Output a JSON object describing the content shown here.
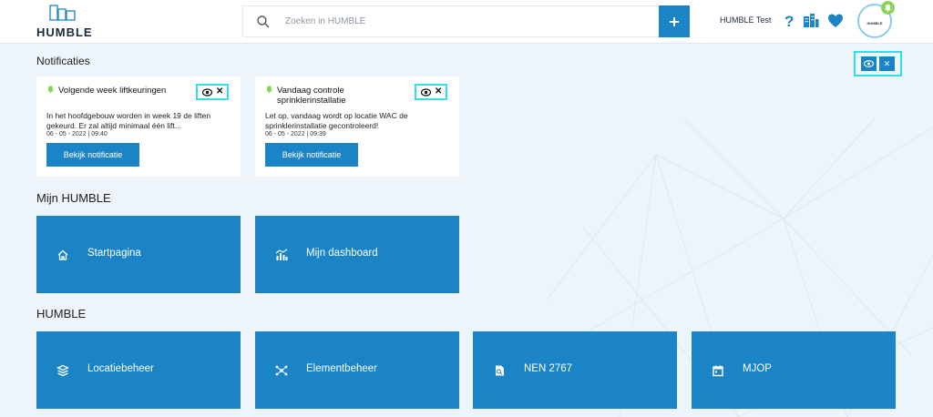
{
  "header": {
    "logo_text": "HUMBLE",
    "search_placeholder": "Zoeken in HUMBLE",
    "add_label": "+",
    "user_name": "HUMBLE Test",
    "avatar_text": "HUMBLE",
    "icons": [
      "search-icon",
      "plus-icon",
      "help-icon",
      "buildings-icon",
      "heart-icon",
      "bell-icon"
    ]
  },
  "notifications": {
    "title": "Notificaties",
    "cards": [
      {
        "title": "Volgende week liftkeuringen",
        "body": "In het hoofdgebouw worden in week 19 de liften gekeurd. Er zal altijd minimaal één lift...",
        "date": "06 - 05 - 2022 | 09:40",
        "button": "Bekijk notificatie"
      },
      {
        "title": "Vandaag controle sprinklerinstallatie",
        "body": "Let op, vandaag wordt op locatie WAC de sprinklerinstallatie gecontroleerd!",
        "date": "06 - 05 - 2022 | 09:39",
        "button": "Bekijk notificatie"
      }
    ],
    "close_glyph": "✕"
  },
  "mijn_humble": {
    "title": "Mijn HUMBLE",
    "tiles": [
      {
        "label": "Startpagina",
        "icon": "home-icon"
      },
      {
        "label": "Mijn dashboard",
        "icon": "dashboard-icon"
      }
    ]
  },
  "humble": {
    "title": "HUMBLE",
    "tiles": [
      {
        "label": "Locatiebeheer",
        "icon": "layers-icon"
      },
      {
        "label": "Elementbeheer",
        "icon": "network-icon"
      },
      {
        "label": "NEN 2767",
        "icon": "document-icon"
      },
      {
        "label": "MJOP",
        "icon": "calendar-icon"
      }
    ]
  },
  "colors": {
    "primary": "#1a84c6",
    "highlight": "#2ee0e8",
    "bell": "#8bd35a",
    "background": "#edf5fa"
  }
}
